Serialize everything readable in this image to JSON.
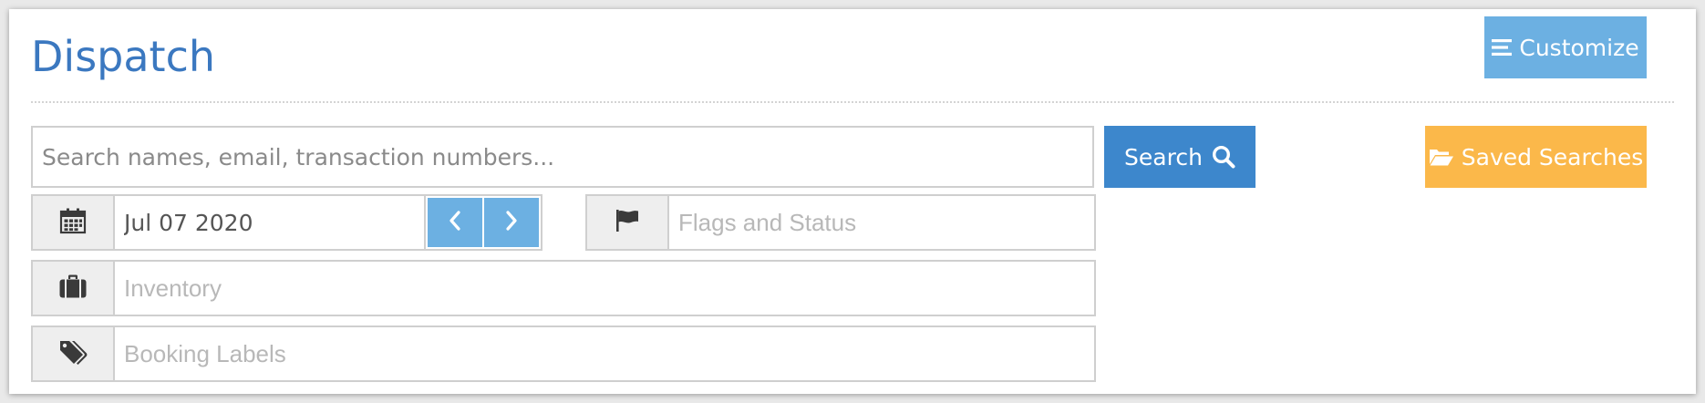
{
  "header": {
    "title": "Dispatch",
    "customize_label": "Customize"
  },
  "search": {
    "placeholder": "Search names, email, transaction numbers...",
    "button_label": "Search",
    "saved_label": "Saved Searches"
  },
  "filters": {
    "date_value": "Jul 07 2020",
    "flags_placeholder": "Flags and Status",
    "inventory_placeholder": "Inventory",
    "labels_placeholder": "Booking Labels"
  },
  "icons": {
    "customize": "list-icon",
    "search": "magnifier-icon",
    "saved": "folder-open-icon",
    "date": "calendar-icon",
    "prev": "chevron-left-icon",
    "next": "chevron-right-icon",
    "flags": "flag-icon",
    "inventory": "briefcase-icon",
    "labels": "tags-icon"
  },
  "colors": {
    "title": "#3b78c0",
    "customize_button": "#6cb0e2",
    "search_button": "#3d87cc",
    "saved_button": "#fbb84a",
    "nav_button": "#6cb0e2"
  }
}
